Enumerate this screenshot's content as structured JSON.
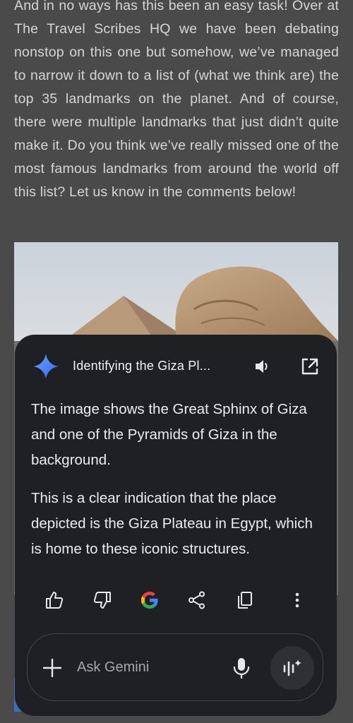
{
  "article": {
    "paragraph": "And in no ways has this been an easy task! Over at The Travel Scribes HQ we have been debating nonstop on this one but somehow, we’ve managed to narrow it down to a list of (what we think are) the top 35 landmarks on the planet. And of course, there were multiple landmarks that just didn’t quite make it. Do you think we’ve really missed one of the most famous landmarks from around the world off this list? Let us know in the comments below!"
  },
  "gemini_panel": {
    "title": "Identifying the Giza Pl...",
    "response_paragraphs": [
      "The image shows the Great Sphinx of Giza and one of the Pyramids of Giza in the background.",
      "This is a clear indication that the place depicted is the Giza Plateau in Egypt, which is home to these iconic structures."
    ],
    "actions": [
      "thumbs-up-icon",
      "thumbs-down-icon",
      "google-icon",
      "share-icon",
      "copy-icon",
      "more-vert-icon"
    ],
    "input": {
      "placeholder": "Ask Gemini",
      "value": ""
    }
  },
  "colors": {
    "page_background": "#4a4a4a",
    "sheet_background": "#1f2023",
    "gemini_gradient_start": "#4f8bf9",
    "gemini_gradient_end": "#2f66e6"
  }
}
